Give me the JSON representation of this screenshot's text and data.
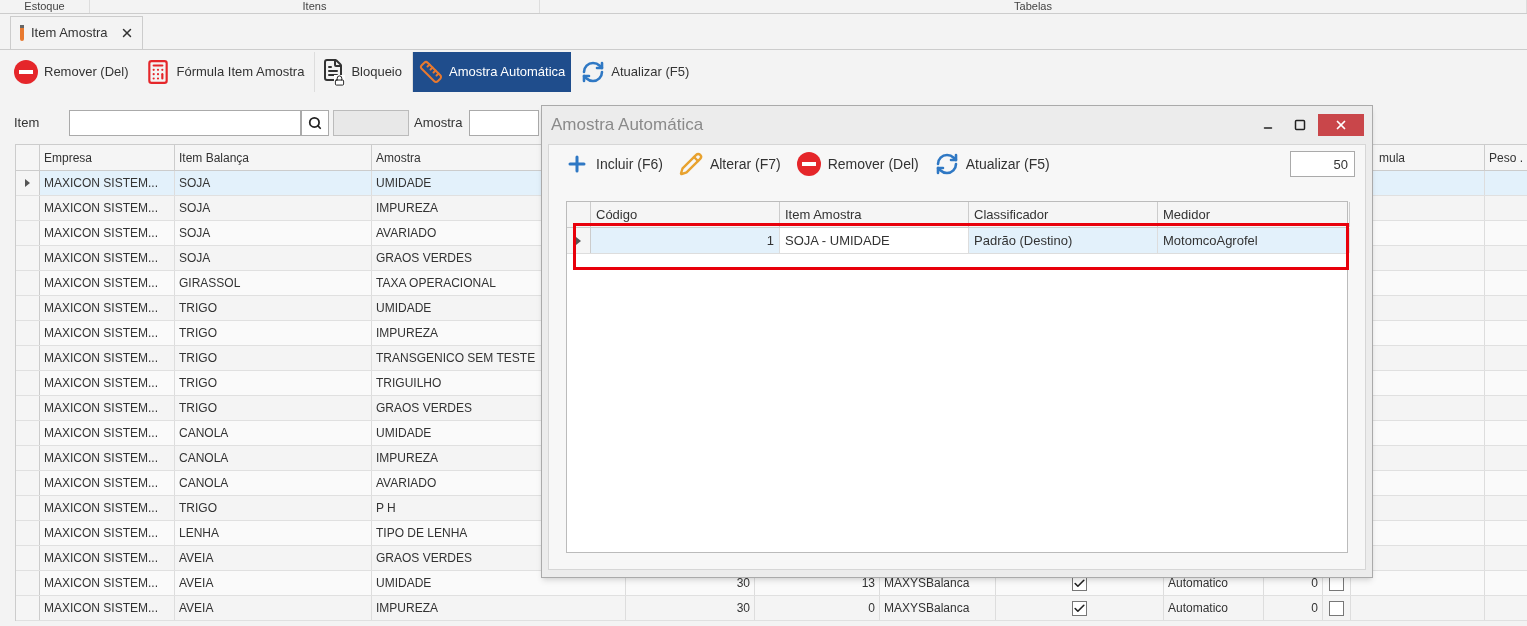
{
  "ribbon_groups": [
    "Estoque",
    "Itens",
    "Tabelas"
  ],
  "document_tab": {
    "label": "Item Amostra",
    "selected": true
  },
  "toolbar": [
    {
      "kind": "remove",
      "label": "Remover (Del)",
      "selected": false
    },
    {
      "kind": "calculator",
      "label": "Fórmula Item Amostra",
      "selected": false
    },
    {
      "kind": "lock",
      "label": "Bloqueio",
      "selected": false
    },
    {
      "kind": "ruler",
      "label": "Amostra Automática",
      "selected": true
    },
    {
      "kind": "refresh",
      "label": "Atualizar (F5)",
      "selected": false
    }
  ],
  "filters": {
    "item_label": "Item",
    "amostra_label": "Amostra"
  },
  "grid": {
    "headers": {
      "empresa": "Empresa",
      "item_balanca": "Item Balança",
      "amostra": "Amostra",
      "column_11": "mula",
      "column_12": "Peso ."
    },
    "rows": [
      {
        "selected": true,
        "empresa": "MAXICON SISTEM...",
        "item_balanca": "SOJA",
        "amostra": "UMIDADE"
      },
      {
        "selected": false,
        "empresa": "MAXICON SISTEM...",
        "item_balanca": "SOJA",
        "amostra": "IMPUREZA"
      },
      {
        "selected": false,
        "empresa": "MAXICON SISTEM...",
        "item_balanca": "SOJA",
        "amostra": "AVARIADO"
      },
      {
        "selected": false,
        "empresa": "MAXICON SISTEM...",
        "item_balanca": "SOJA",
        "amostra": "GRAOS VERDES"
      },
      {
        "selected": false,
        "empresa": "MAXICON SISTEM...",
        "item_balanca": "GIRASSOL",
        "amostra": "TAXA OPERACIONAL"
      },
      {
        "selected": false,
        "empresa": "MAXICON SISTEM...",
        "item_balanca": "TRIGO",
        "amostra": "UMIDADE"
      },
      {
        "selected": false,
        "empresa": "MAXICON SISTEM...",
        "item_balanca": "TRIGO",
        "amostra": "IMPUREZA"
      },
      {
        "selected": false,
        "empresa": "MAXICON SISTEM...",
        "item_balanca": "TRIGO",
        "amostra": "TRANSGENICO SEM TESTE"
      },
      {
        "selected": false,
        "empresa": "MAXICON SISTEM...",
        "item_balanca": "TRIGO",
        "amostra": "TRIGUILHO"
      },
      {
        "selected": false,
        "empresa": "MAXICON SISTEM...",
        "item_balanca": "TRIGO",
        "amostra": "GRAOS VERDES"
      },
      {
        "selected": false,
        "empresa": "MAXICON SISTEM...",
        "item_balanca": "CANOLA",
        "amostra": "UMIDADE"
      },
      {
        "selected": false,
        "empresa": "MAXICON SISTEM...",
        "item_balanca": "CANOLA",
        "amostra": "IMPUREZA"
      },
      {
        "selected": false,
        "empresa": "MAXICON SISTEM...",
        "item_balanca": "CANOLA",
        "amostra": "AVARIADO"
      },
      {
        "selected": false,
        "empresa": "MAXICON SISTEM...",
        "item_balanca": "TRIGO",
        "amostra": "P H"
      },
      {
        "selected": false,
        "empresa": "MAXICON SISTEM...",
        "item_balanca": "LENHA",
        "amostra": "TIPO DE LENHA"
      },
      {
        "selected": false,
        "empresa": "MAXICON SISTEM...",
        "item_balanca": "AVEIA",
        "amostra": "GRAOS VERDES"
      },
      {
        "selected": false,
        "empresa": "MAXICON SISTEM...",
        "item_balanca": "AVEIA",
        "amostra": "UMIDADE",
        "column_4": "30",
        "column_5": "13",
        "column_6": "MAXYSBalanca",
        "column_7": {
          "checked": true
        },
        "column_8": "Automatico",
        "column_9": "0",
        "column_10": {
          "checked": false
        }
      },
      {
        "selected": false,
        "empresa": "MAXICON SISTEM...",
        "item_balanca": "AVEIA",
        "amostra": "IMPUREZA",
        "column_4": "30",
        "column_5": "0",
        "column_6": "MAXYSBalanca",
        "column_7": {
          "checked": true
        },
        "column_8": "Automatico",
        "column_9": "0",
        "column_10": {
          "checked": false
        }
      }
    ]
  },
  "dialog": {
    "title": "Amostra Automática",
    "toolbar": [
      {
        "kind": "plus",
        "label": "Incluir (F6)"
      },
      {
        "kind": "pencil",
        "label": "Alterar (F7)"
      },
      {
        "kind": "remove",
        "label": "Remover (Del)"
      },
      {
        "kind": "refresh",
        "label": "Atualizar (F5)"
      }
    ],
    "page_size": "50",
    "columns": [
      "Código",
      "Item Amostra",
      "Classificador",
      "Medidor"
    ],
    "rows": [
      {
        "selected": true,
        "codigo": "1",
        "item_amostra": "SOJA - UMIDADE",
        "classificador": "Padrão (Destino)",
        "medidor": "MotomcoAgrofel"
      }
    ]
  }
}
